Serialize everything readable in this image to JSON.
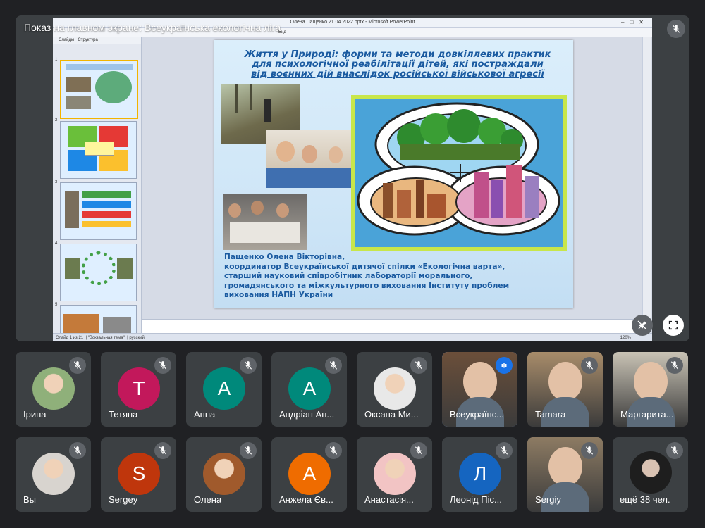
{
  "presentation": {
    "banner": "Показ на главном экране: Всеукраїнська екологічна ліга",
    "window_title": "Олена Пащенко 21.04.2022.pptx - Microsoft PowerPoint",
    "ribbon_label": "Вид",
    "left_tabs": [
      "Слайды",
      "Структура"
    ],
    "thumb_numbers": [
      "1",
      "2",
      "3",
      "4",
      "5"
    ],
    "slide": {
      "title_lines": [
        "Життя у Природі: форми та методи довкіллевих практик",
        "для психологічної реабілітації дітей, які постраждали",
        "від воєнних дій внаслідок російської військової агресії"
      ],
      "author_lines": [
        "Пащенко Олена Вікторівна,",
        "координатор Всеукраїнської дитячої спілки «Екологічна варта»,",
        "старший науковий співробітник  лабораторії морального,",
        "громадянського та міжкультурного виховання  Інституту проблем"
      ],
      "author_last_prefix": "виховання ",
      "author_last_underlined": "НАПН",
      "author_last_suffix": " України"
    },
    "status_left": "Слайд 1 из 21",
    "status_theme": "\"Вокзальная тема\"",
    "status_lang": "русский",
    "zoom": "120%"
  },
  "controls": {
    "stage_mic_icon": "mic-off-icon",
    "pin_icon": "unpin-icon",
    "fullscreen_icon": "fullscreen-icon"
  },
  "participants": [
    {
      "name": "Ірина",
      "type": "photo",
      "color": "#8fb07a"
    },
    {
      "name": "Тетяна",
      "type": "initial",
      "initial": "T",
      "color": "#c2185b"
    },
    {
      "name": "Анна",
      "type": "initial",
      "initial": "A",
      "color": "#00897b"
    },
    {
      "name": "Андріан Ан...",
      "type": "initial",
      "initial": "A",
      "color": "#00897b"
    },
    {
      "name": "Оксана Ми...",
      "type": "photo",
      "color": "#e8e8e8"
    },
    {
      "name": "Всеукраїнс...",
      "type": "video",
      "color": "#6b4f3a",
      "speaking": true
    },
    {
      "name": "Tamara",
      "type": "video",
      "color": "#a88c6a"
    },
    {
      "name": "Маргарита...",
      "type": "video",
      "color": "#c9c3b5"
    },
    {
      "name": "Вы",
      "type": "photo",
      "color": "#d8d4cf"
    },
    {
      "name": "Sergey",
      "type": "initial",
      "initial": "S",
      "color": "#bf360c"
    },
    {
      "name": "Олена",
      "type": "photo",
      "color": "#a05a2c"
    },
    {
      "name": "Анжела Єв...",
      "type": "initial",
      "initial": "A",
      "color": "#ef6c00"
    },
    {
      "name": "Анастасія...",
      "type": "photo",
      "color": "#f2c4c4"
    },
    {
      "name": "Леонід Піс...",
      "type": "initial",
      "initial": "Л",
      "color": "#1565c0"
    },
    {
      "name": "Sergiy",
      "type": "video",
      "color": "#8d7b63"
    },
    {
      "name": "ещё 38 чел.",
      "type": "more",
      "color": "#2b2b2b"
    }
  ]
}
